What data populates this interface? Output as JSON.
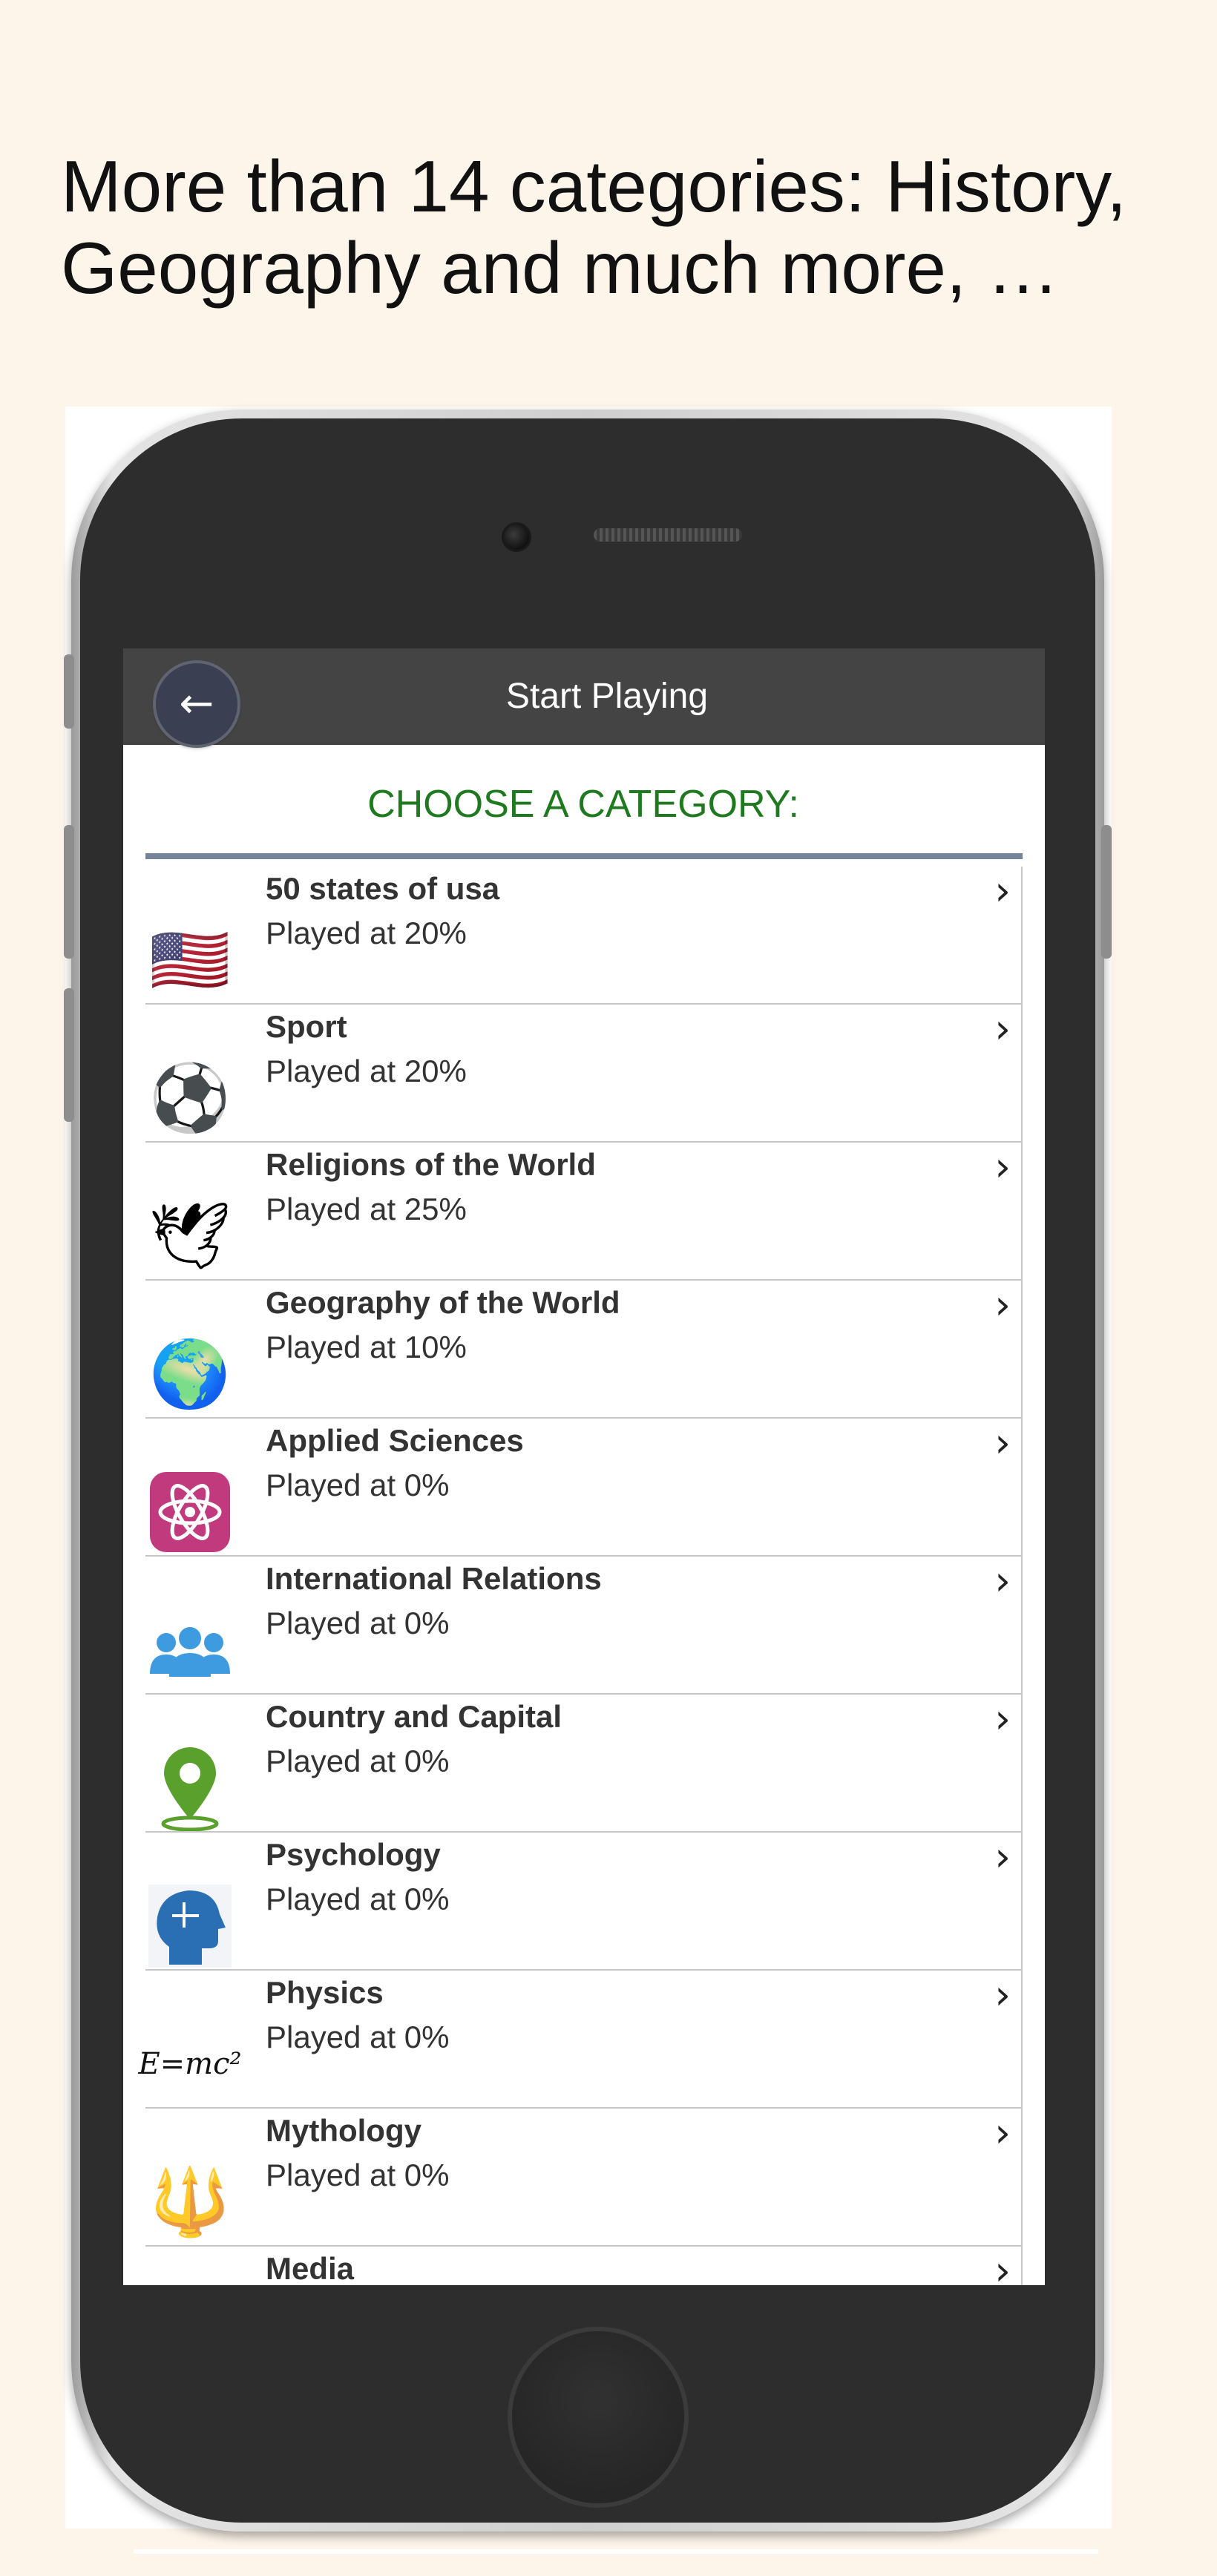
{
  "promo": {
    "line1": "More than 14 categories: History,",
    "line2": "Geography and much more, …"
  },
  "header": {
    "title": "Start Playing",
    "back_icon": "arrow-left-icon"
  },
  "list_heading": "CHOOSE A CATEGORY:",
  "categories": [
    {
      "title": "50 states of usa",
      "status": "Played at 20%",
      "progress": 20,
      "icon": "us-flag-icon",
      "glyph": "🇺🇸"
    },
    {
      "title": "Sport",
      "status": "Played at 20%",
      "progress": 20,
      "icon": "soccer-ball-icon",
      "glyph": "⚽"
    },
    {
      "title": "Religions of the World",
      "status": "Played at 25%",
      "progress": 25,
      "icon": "dove-icon",
      "glyph": "🕊"
    },
    {
      "title": "Geography of the World",
      "status": "Played at 10%",
      "progress": 10,
      "icon": "globe-icon",
      "glyph": "🌍"
    },
    {
      "title": "Applied Sciences",
      "status": "Played at 0%",
      "progress": 0,
      "icon": "atom-icon",
      "glyph": "⚛"
    },
    {
      "title": "International Relations",
      "status": "Played at 0%",
      "progress": 0,
      "icon": "people-group-icon",
      "glyph": "👥"
    },
    {
      "title": "Country and Capital",
      "status": "Played at 0%",
      "progress": 0,
      "icon": "map-pin-icon",
      "glyph": "📍"
    },
    {
      "title": "Psychology",
      "status": "Played at 0%",
      "progress": 0,
      "icon": "head-puzzle-icon",
      "glyph": "🧩"
    },
    {
      "title": "Physics",
      "status": "Played at 0%",
      "progress": 0,
      "icon": "e-mc2-icon",
      "glyph": "E=mc²"
    },
    {
      "title": "Mythology",
      "status": "Played at 0%",
      "progress": 0,
      "icon": "trident-icon",
      "glyph": "🔱"
    },
    {
      "title": "Media",
      "status": "",
      "progress": null,
      "icon": "media-icon",
      "glyph": ""
    }
  ],
  "colors": {
    "background": "#fdf5ea",
    "header": "#444444",
    "heading": "#1f7a1f",
    "rule": "#74849a"
  }
}
